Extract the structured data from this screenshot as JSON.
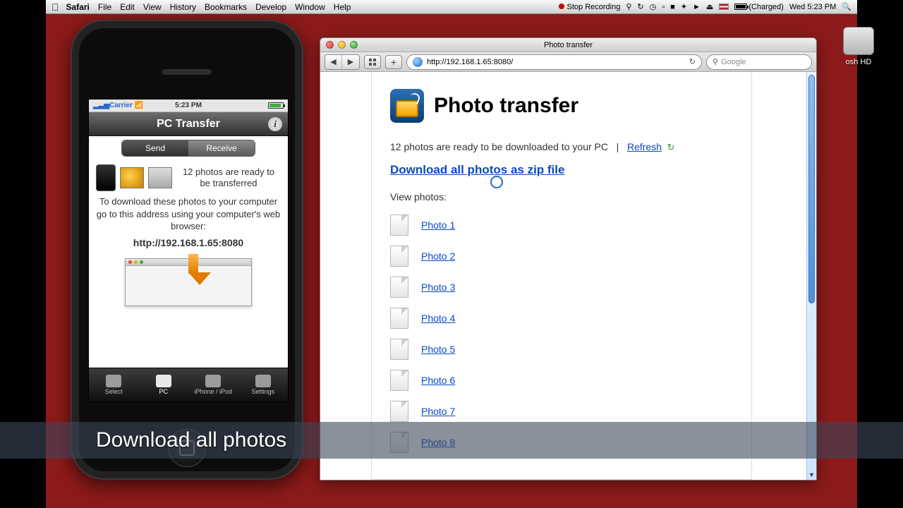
{
  "menubar": {
    "app_name": "Safari",
    "items": [
      "File",
      "Edit",
      "View",
      "History",
      "Bookmarks",
      "Develop",
      "Window",
      "Help"
    ],
    "stop_recording": "Stop Recording",
    "battery_label": "(Charged)",
    "clock": "Wed 5:23 PM"
  },
  "desktop": {
    "hdd_label": "osh HD"
  },
  "safari": {
    "title": "Photo transfer",
    "url": "http://192.168.1.65:8080/",
    "search_placeholder": "Google"
  },
  "page": {
    "heading": "Photo transfer",
    "status": "12 photos are ready to be downloaded to your PC",
    "separator": "|",
    "refresh": "Refresh",
    "download_link": "Download all photos as zip file",
    "view_label": "View photos:",
    "photos": [
      "Photo 1",
      "Photo 2",
      "Photo 3",
      "Photo 4",
      "Photo 5",
      "Photo 6",
      "Photo 7",
      "Photo 8"
    ]
  },
  "phone": {
    "carrier": "Carrier",
    "time": "5:23 PM",
    "title": "PC Transfer",
    "seg_send": "Send",
    "seg_receive": "Receive",
    "ready_text": "12 photos are ready to be transferred",
    "instructions": "To download these photos to your computer go to this address using your computer's web browser:",
    "ip": "http://192.168.1.65:8080",
    "tabs": [
      "Select",
      "PC",
      "iPhone / iPod",
      "Settings"
    ]
  },
  "caption": "Download all photos"
}
